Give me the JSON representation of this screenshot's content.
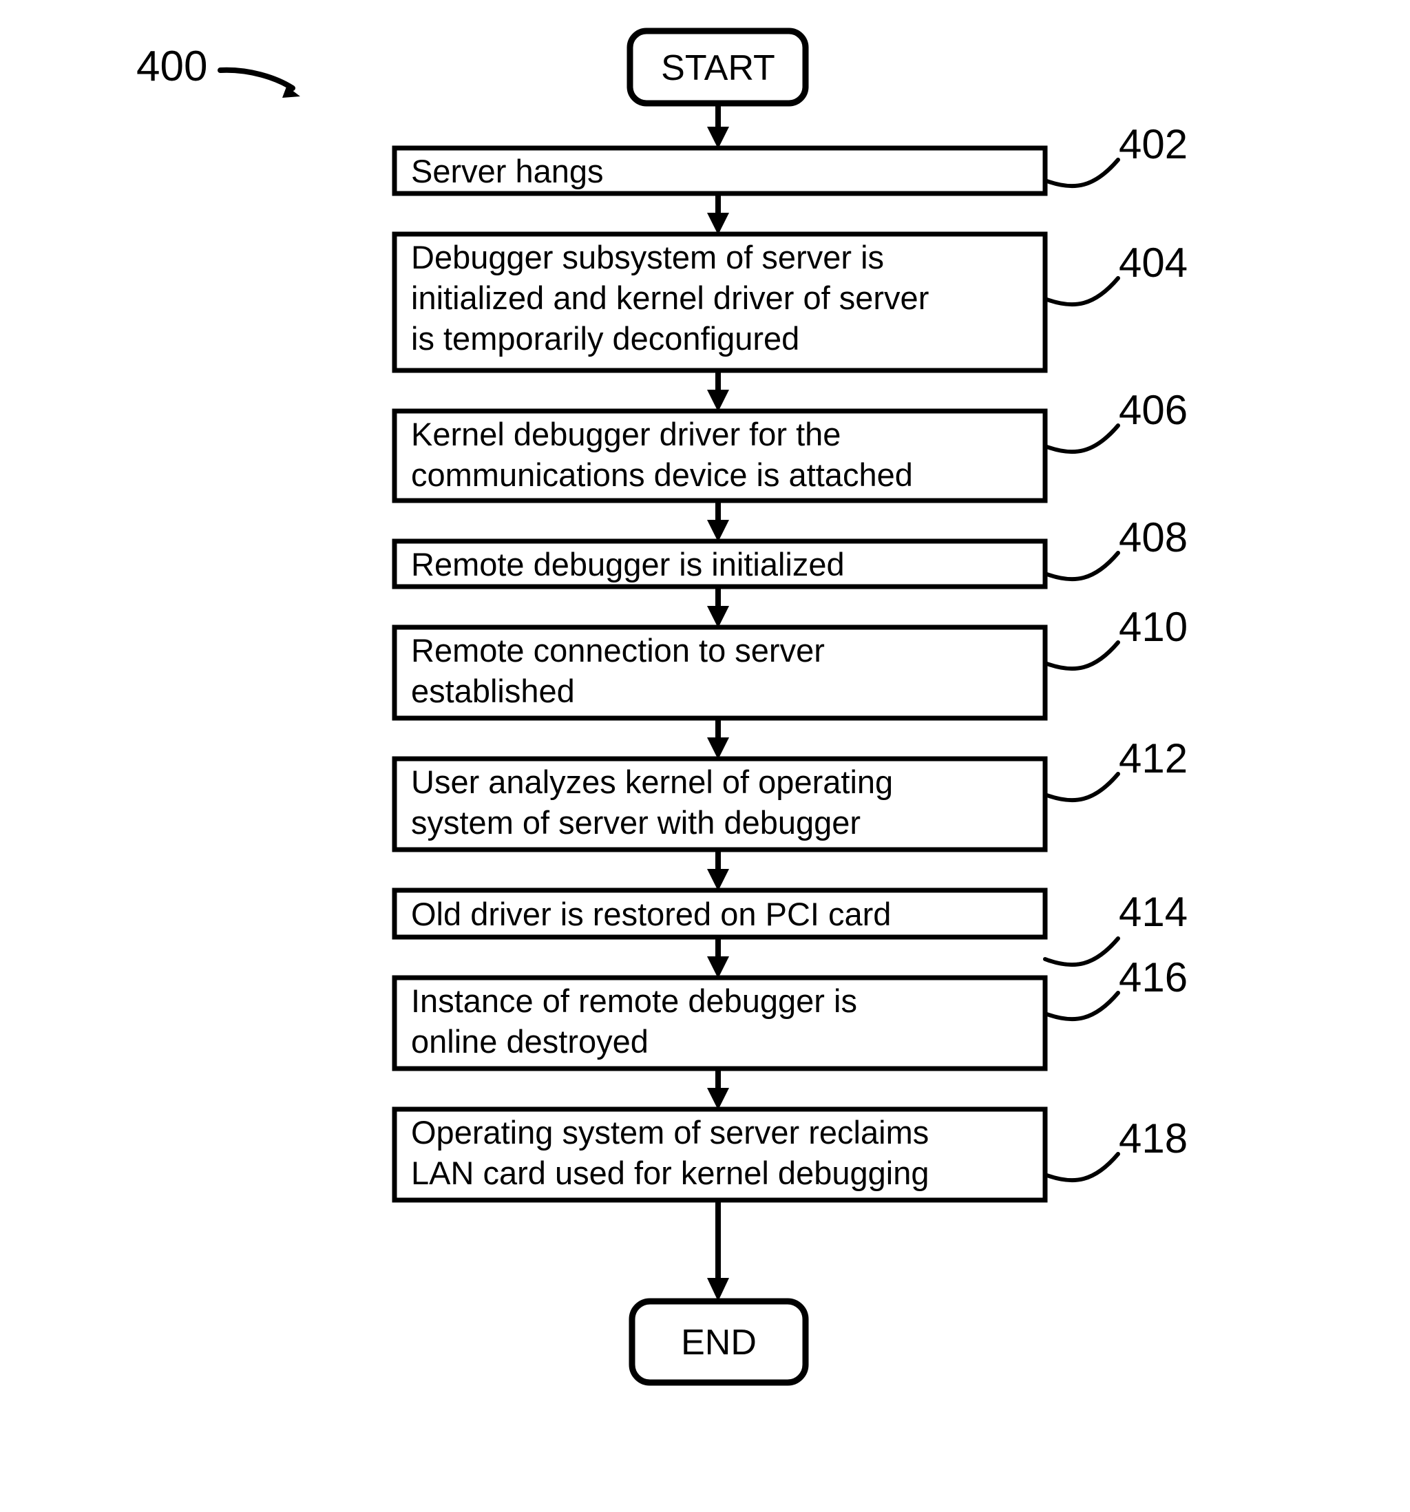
{
  "figure": {
    "number": "400",
    "title_arrow": "curved-pointer-icon"
  },
  "terminals": {
    "start": "START",
    "end": "END"
  },
  "steps": [
    {
      "ref": "402",
      "lines": [
        "Server hangs"
      ]
    },
    {
      "ref": "404",
      "lines": [
        "Debugger subsystem of server is",
        "initialized and kernel driver of server",
        "is temporarily deconfigured"
      ]
    },
    {
      "ref": "406",
      "lines": [
        "Kernel debugger driver for the",
        "communications device is attached"
      ]
    },
    {
      "ref": "408",
      "lines": [
        "Remote debugger is initialized"
      ]
    },
    {
      "ref": "410",
      "lines": [
        "Remote connection to server",
        "established"
      ]
    },
    {
      "ref": "412",
      "lines": [
        "User analyzes kernel of operating",
        "system of server with debugger"
      ]
    },
    {
      "ref": "414",
      "lines": [
        "Old driver is restored on PCI card"
      ]
    },
    {
      "ref": "416",
      "lines": [
        "Instance of remote debugger is",
        "online destroyed"
      ]
    },
    {
      "ref": "418",
      "lines": [
        "Operating system of server reclaims",
        "LAN card used for kernel debugging"
      ]
    }
  ],
  "colors": {
    "stroke": "#000000",
    "fill": "#ffffff",
    "text": "#000000"
  }
}
